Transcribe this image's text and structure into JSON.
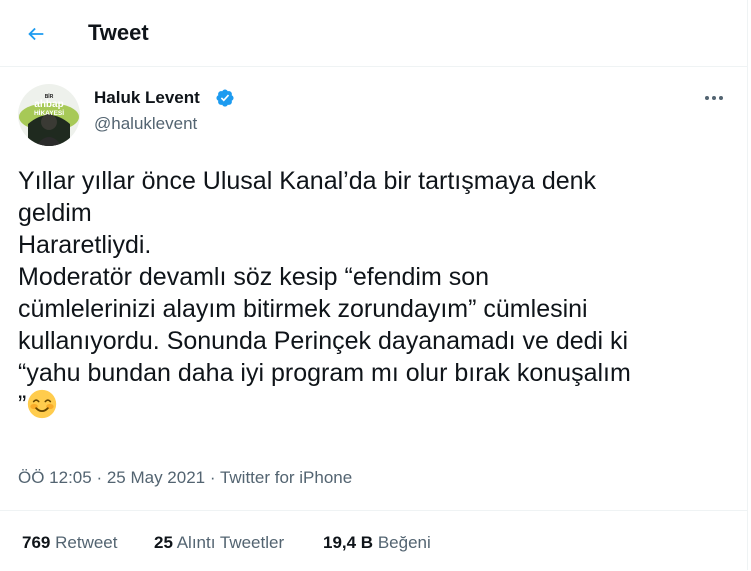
{
  "header": {
    "title": "Tweet"
  },
  "author": {
    "name": "Haluk Levent",
    "handle": "@haluklevent",
    "avatar_text": [
      "BİR",
      "ahbap",
      "HİKAYESİ"
    ]
  },
  "tweet": {
    "lines": [
      "Yıllar yıllar önce Ulusal Kanal’da bir tartışmaya denk",
      "geldim",
      "Hararetliydi.",
      "Moderatör devamlı söz kesip “efendim son",
      "cümlelerinizi alayım bitirmek zorundayım” cümlesini",
      "kullanıyordu. Sonunda Perinçek dayanamadı ve dedi ki",
      "“yahu bundan daha iyi program mı olur bırak konuşalım",
      "”"
    ],
    "emoji": "smiling-face-with-blush"
  },
  "meta": {
    "time": "ÖÖ 12:05",
    "sep1": " · ",
    "date": "25 May 2021",
    "sep2": " · ",
    "source": "Twitter for iPhone"
  },
  "stats": {
    "retweets": {
      "count": "769",
      "label": "Retweet"
    },
    "quotes": {
      "count": "25",
      "label": "Alıntı Tweetler"
    },
    "likes": {
      "count": "19,4 B",
      "label": "Beğeni"
    }
  },
  "colors": {
    "accent": "#1d9bf0",
    "text": "#0f1419",
    "secondary": "#536471",
    "border": "#eff3f4"
  }
}
